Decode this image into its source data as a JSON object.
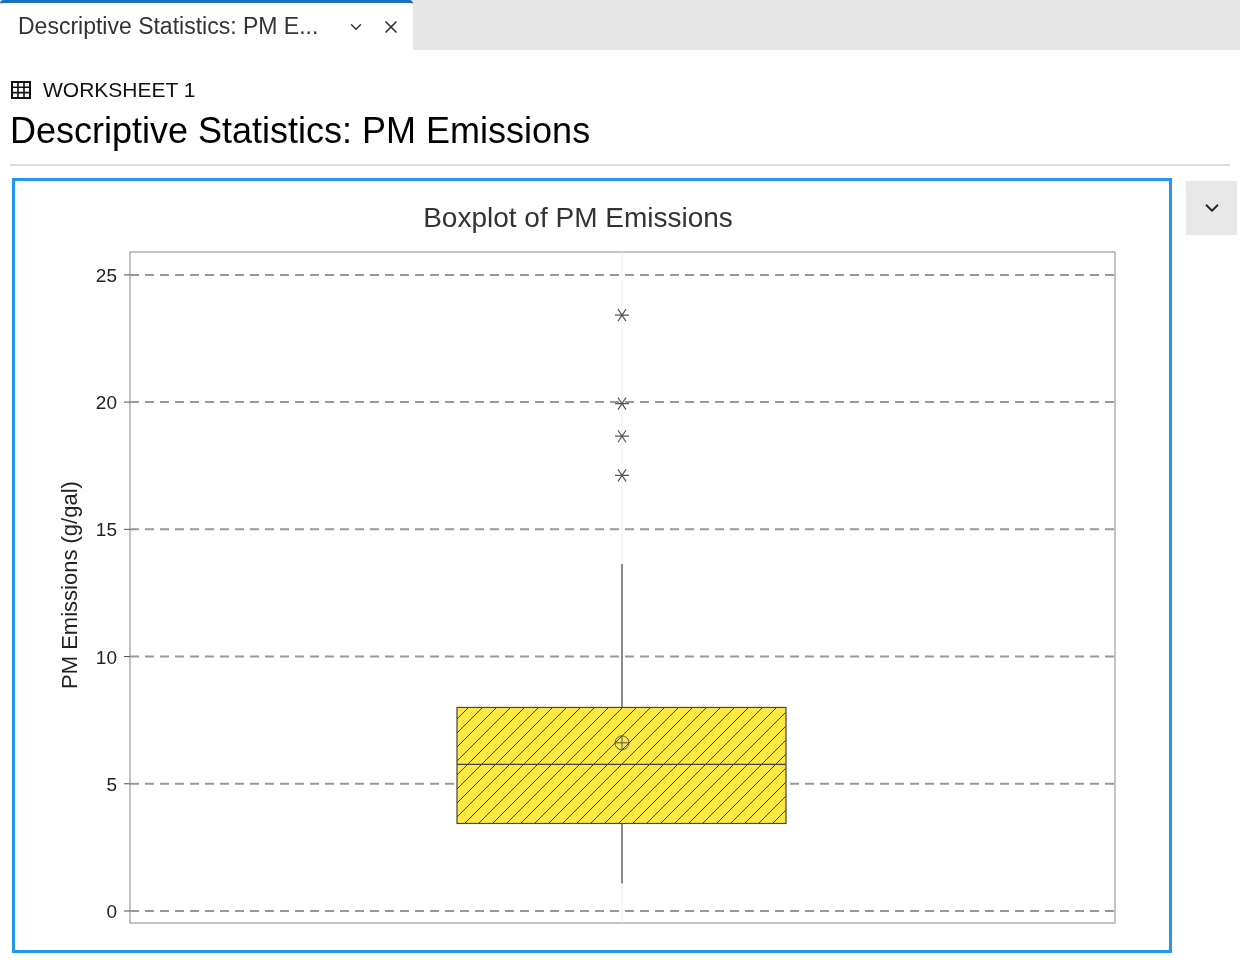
{
  "tabs": [
    {
      "label": "Descriptive Statistics: PM E...",
      "selected": true
    }
  ],
  "worksheet": {
    "label": "WORKSHEET 1"
  },
  "heading": "Descriptive Statistics: PM Emissions",
  "graph": {
    "selected": true,
    "title": "Boxplot of PM Emissions",
    "y_axis_label": "PM Emissions (g/gal)",
    "y_tick_labels": [
      "25",
      "20",
      "15",
      "10",
      "5",
      "0"
    ]
  }
}
